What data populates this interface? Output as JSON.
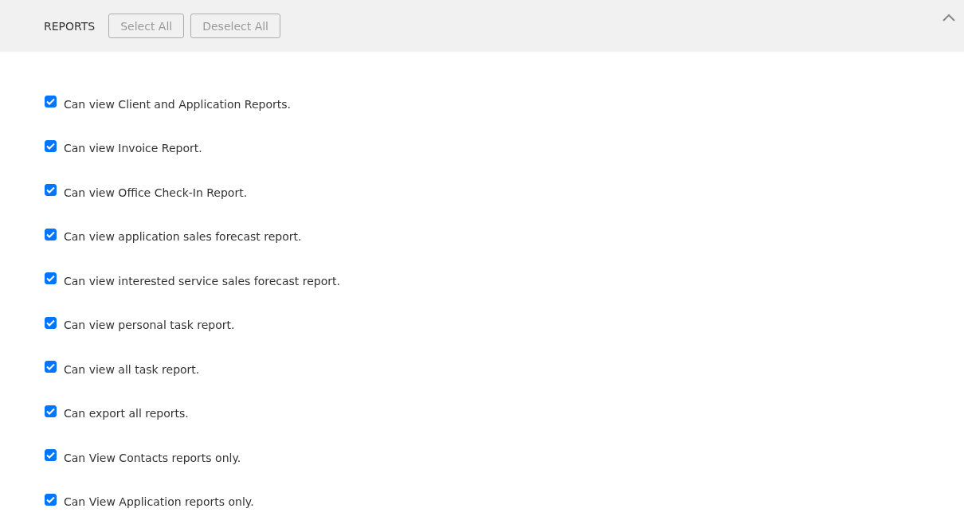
{
  "header": {
    "title": "REPORTS",
    "expanded": true,
    "buttons": [
      {
        "label": "Select All",
        "disabled": true
      },
      {
        "label": "Deselect All",
        "disabled": true
      }
    ]
  },
  "permissions": [
    {
      "label": "Can view Client and Application Reports.",
      "checked": true
    },
    {
      "label": "Can view Invoice Report.",
      "checked": true
    },
    {
      "label": "Can view Office Check-In Report.",
      "checked": true
    },
    {
      "label": "Can view application sales forecast report.",
      "checked": true
    },
    {
      "label": "Can view interested service sales forecast report.",
      "checked": true
    },
    {
      "label": "Can view personal task report.",
      "checked": true
    },
    {
      "label": "Can view all task report.",
      "checked": true
    },
    {
      "label": "Can export all reports.",
      "checked": true
    },
    {
      "label": "Can View Contacts reports only.",
      "checked": true
    },
    {
      "label": "Can View Application reports only.",
      "checked": true
    }
  ]
}
